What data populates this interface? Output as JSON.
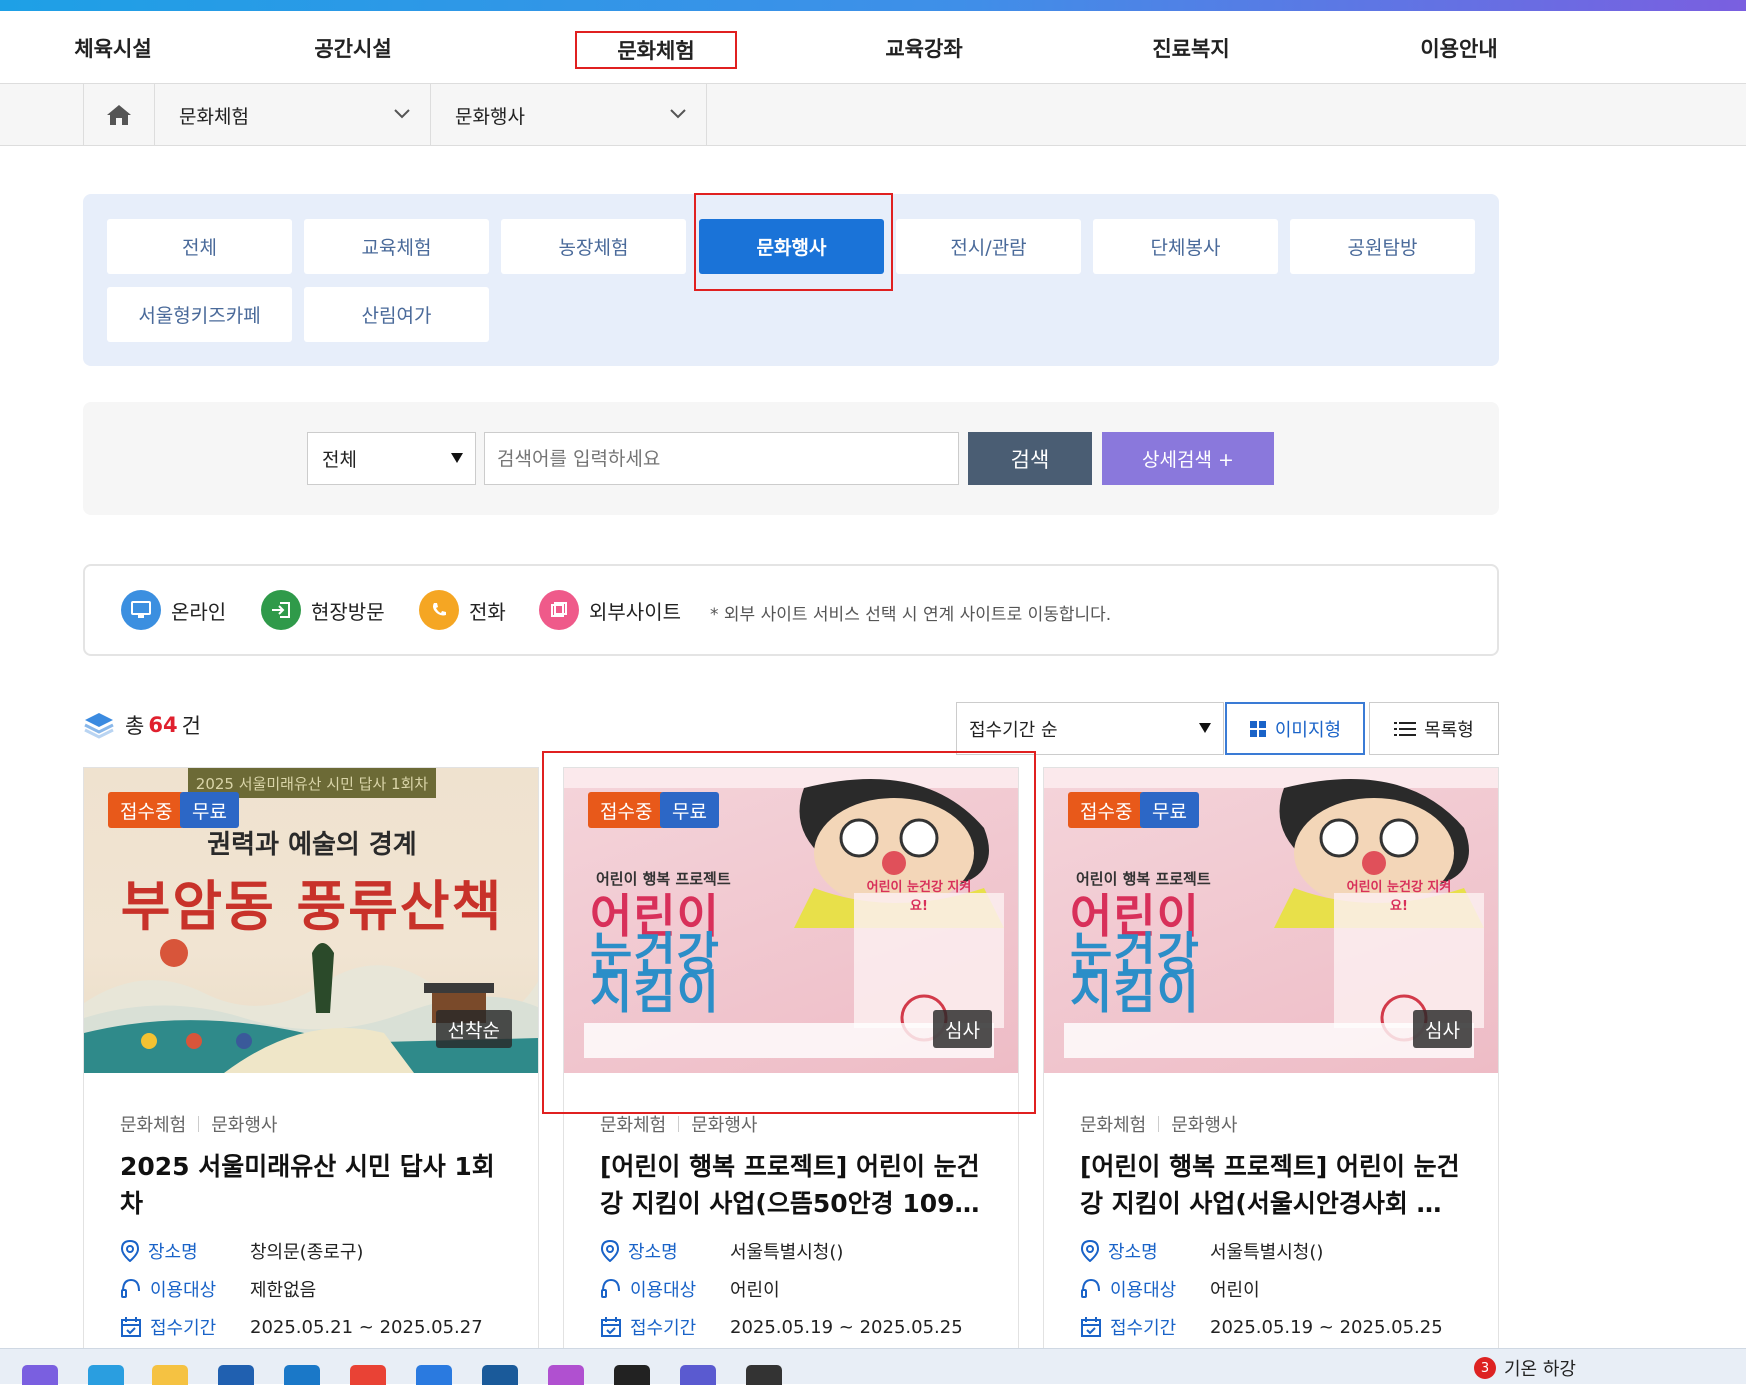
{
  "gnb": {
    "items": [
      {
        "label": "체육시설"
      },
      {
        "label": "공간시설"
      },
      {
        "label": "문화체험"
      },
      {
        "label": "교육강좌"
      },
      {
        "label": "진료복지"
      },
      {
        "label": "이용안내"
      }
    ],
    "active_index": 2
  },
  "breadcrumb": {
    "level1": "문화체험",
    "level2": "문화행사"
  },
  "categories": {
    "items": [
      "전체",
      "교육체험",
      "농장체험",
      "문화행사",
      "전시/관람",
      "단체봉사",
      "공원탐방",
      "서울형키즈카페",
      "산림여가"
    ],
    "active": "문화행사"
  },
  "search": {
    "select_value": "전체",
    "placeholder": "검색어를 입력하세요",
    "search_label": "검색",
    "detail_label": "상세검색 +"
  },
  "legend": {
    "online": "온라인",
    "visit": "현장방문",
    "phone": "전화",
    "external": "외부사이트",
    "note": "* 외부 사이트 서비스 선택 시 연계 사이트로 이동합니다."
  },
  "results": {
    "total_prefix": "총",
    "total_count": "64",
    "total_suffix": "건",
    "sort_value": "접수기간 순",
    "view_image": "이미지형",
    "view_list": "목록형"
  },
  "cards": [
    {
      "status": "접수중",
      "fee": "무료",
      "tag": "선착순",
      "category1": "문화체험",
      "category2": "문화행사",
      "title": "2025 서울미래유산 시민 답사 1회차",
      "place_label": "장소명",
      "place": "창의문(종로구)",
      "target_label": "이용대상",
      "target": "제한없음",
      "period_label": "접수기간",
      "period": "2025.05.21 ~ 2025.05.27",
      "poster": {
        "top": "2025 서울미래유산 시민 답사 1회차",
        "sub": "권력과 예술의 경계",
        "main": "부암동 풍류산책"
      }
    },
    {
      "status": "접수중",
      "fee": "무료",
      "tag": "심사",
      "category1": "문화체험",
      "category2": "문화행사",
      "title": "[어린이 행복 프로젝트] 어린이 눈건강 지킴이 사업(으뜸50안경 109…",
      "place_label": "장소명",
      "place": "서울특별시청()",
      "target_label": "이용대상",
      "target": "어린이",
      "period_label": "접수기간",
      "period": "2025.05.19 ~ 2025.05.25",
      "poster": {
        "small": "어린이 행복 프로젝트",
        "line1": "어린이",
        "line2": "눈건강",
        "line3": "지킴이",
        "bubble": "어린이 눈건강 지켜요!"
      }
    },
    {
      "status": "접수중",
      "fee": "무료",
      "tag": "심사",
      "category1": "문화체험",
      "category2": "문화행사",
      "title": "[어린이 행복 프로젝트] 어린이 눈건강 지킴이 사업(서울시안경사회 …",
      "place_label": "장소명",
      "place": "서울특별시청()",
      "target_label": "이용대상",
      "target": "어린이",
      "period_label": "접수기간",
      "period": "2025.05.19 ~ 2025.05.25",
      "poster": {
        "small": "어린이 행복 프로젝트",
        "line1": "어린이",
        "line2": "눈건강",
        "line3": "지킴이",
        "bubble": "어린이 눈건강 지켜요!"
      }
    }
  ],
  "taskbar": {
    "weather_badge": "3",
    "weather_text": "기온 하강"
  },
  "colors": {
    "accent": "#1a73d8",
    "highlight_box": "#e02020",
    "count": "#e0202e",
    "status_orange": "#e8591a",
    "fee_blue": "#2c67c6",
    "detail_btn": "#8a78dc"
  }
}
